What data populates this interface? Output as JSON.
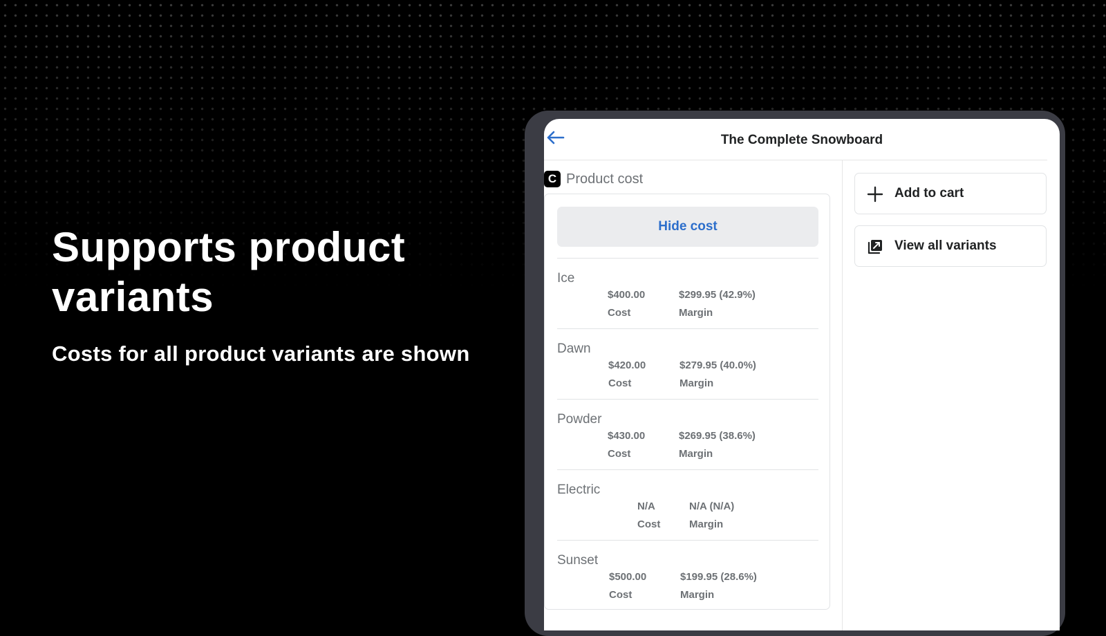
{
  "promo": {
    "headline": "Supports product variants",
    "subline": "Costs for all product variants are shown"
  },
  "app": {
    "title": "The Complete Snowboard",
    "section_title": "Product cost",
    "logo_letter": "C",
    "hide_cost_label": "Hide cost",
    "actions": [
      {
        "label": "Add to cart",
        "icon": "plus-icon"
      },
      {
        "label": "View all variants",
        "icon": "variants-icon"
      }
    ],
    "variants": [
      {
        "name": "Ice",
        "cost": "$400.00",
        "cost_label": "Cost",
        "margin": "$299.95 (42.9%)",
        "margin_label": "Margin"
      },
      {
        "name": "Dawn",
        "cost": "$420.00",
        "cost_label": "Cost",
        "margin": "$279.95 (40.0%)",
        "margin_label": "Margin"
      },
      {
        "name": "Powder",
        "cost": "$430.00",
        "cost_label": "Cost",
        "margin": "$269.95 (38.6%)",
        "margin_label": "Margin"
      },
      {
        "name": "Electric",
        "cost": "N/A",
        "cost_label": "Cost",
        "margin": "N/A (N/A)",
        "margin_label": "Margin"
      },
      {
        "name": "Sunset",
        "cost": "$500.00",
        "cost_label": "Cost",
        "margin": "$199.95 (28.6%)",
        "margin_label": "Margin"
      }
    ],
    "colors": {
      "link_blue": "#2c6ecb",
      "device_frame": "#3b3c44",
      "text_subdued": "#6d7175"
    }
  }
}
